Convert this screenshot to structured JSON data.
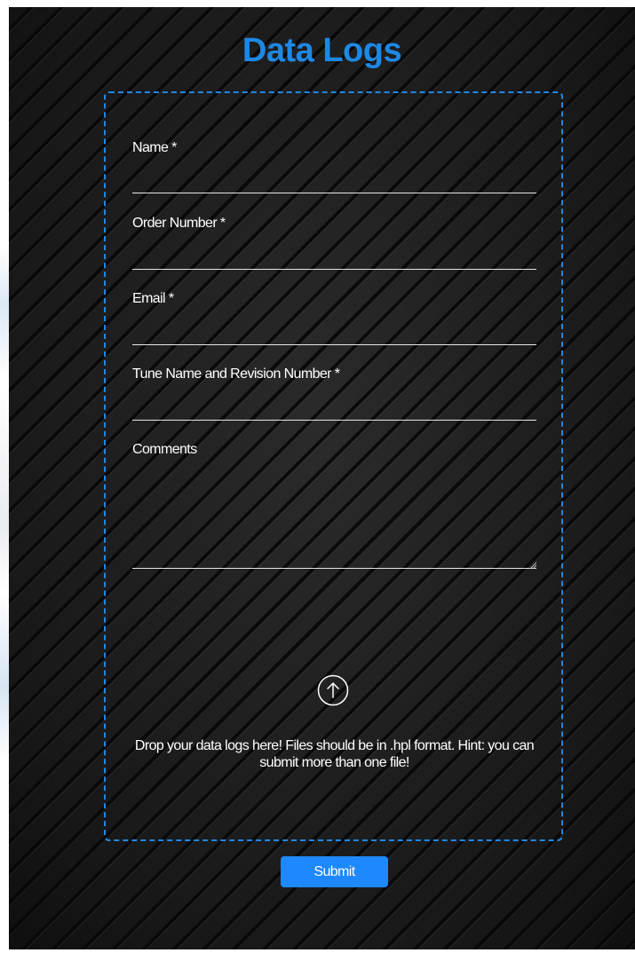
{
  "page": {
    "title": "Data Logs"
  },
  "form": {
    "fields": [
      {
        "label": "Name *",
        "value": ""
      },
      {
        "label": "Order Number *",
        "value": ""
      },
      {
        "label": "Email *",
        "value": ""
      },
      {
        "label": "Tune Name and Revision Number *",
        "value": ""
      },
      {
        "label": "Comments",
        "value": ""
      }
    ],
    "upload": {
      "icon": "upload-arrow-icon",
      "message": "Drop your data logs here! Files should be in .hpl format. Hint: you can submit more than one file!"
    },
    "submit_label": "Submit"
  },
  "colors": {
    "accent": "#1e88e5",
    "button": "#1e88ff",
    "background": "#1b1b1b",
    "text": "#ffffff"
  }
}
